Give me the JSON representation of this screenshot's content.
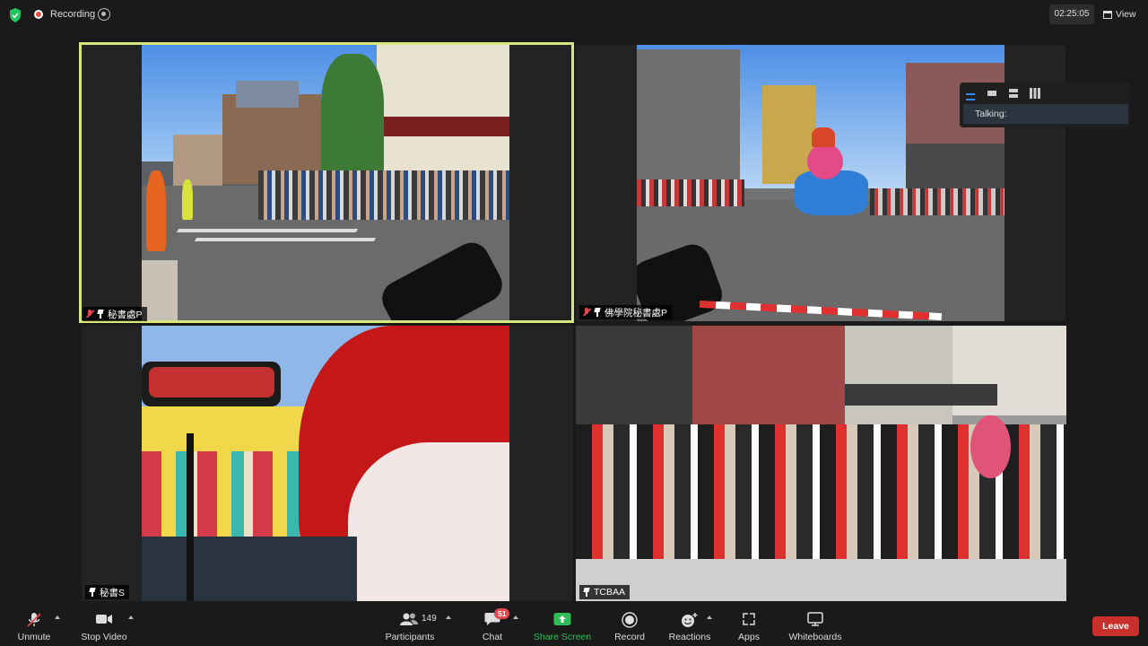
{
  "topbar": {
    "recording_label": "Recording",
    "timer": "02:25:05",
    "view_label": "View"
  },
  "tiles": [
    {
      "name": "秘書處P",
      "muted": true,
      "active": true
    },
    {
      "name": "佛學院秘書處P",
      "muted": true,
      "active": false
    },
    {
      "name": "秘書S",
      "muted": false,
      "active": false
    },
    {
      "name": "TCBAA",
      "muted": false,
      "active": false
    }
  ],
  "view_panel": {
    "talking_label": "Talking:"
  },
  "toolbar": {
    "unmute": "Unmute",
    "stop_video": "Stop Video",
    "participants": "Participants",
    "participants_count": "149",
    "chat": "Chat",
    "chat_badge": "51",
    "share_screen": "Share Screen",
    "record": "Record",
    "reactions": "Reactions",
    "apps": "Apps",
    "whiteboards": "Whiteboards",
    "leave": "Leave"
  },
  "colors": {
    "active_speaker_border": "#d9e67a",
    "share_screen_green": "#2ebd59",
    "leave_red": "#c9302c",
    "muted_red": "#e5484d"
  }
}
